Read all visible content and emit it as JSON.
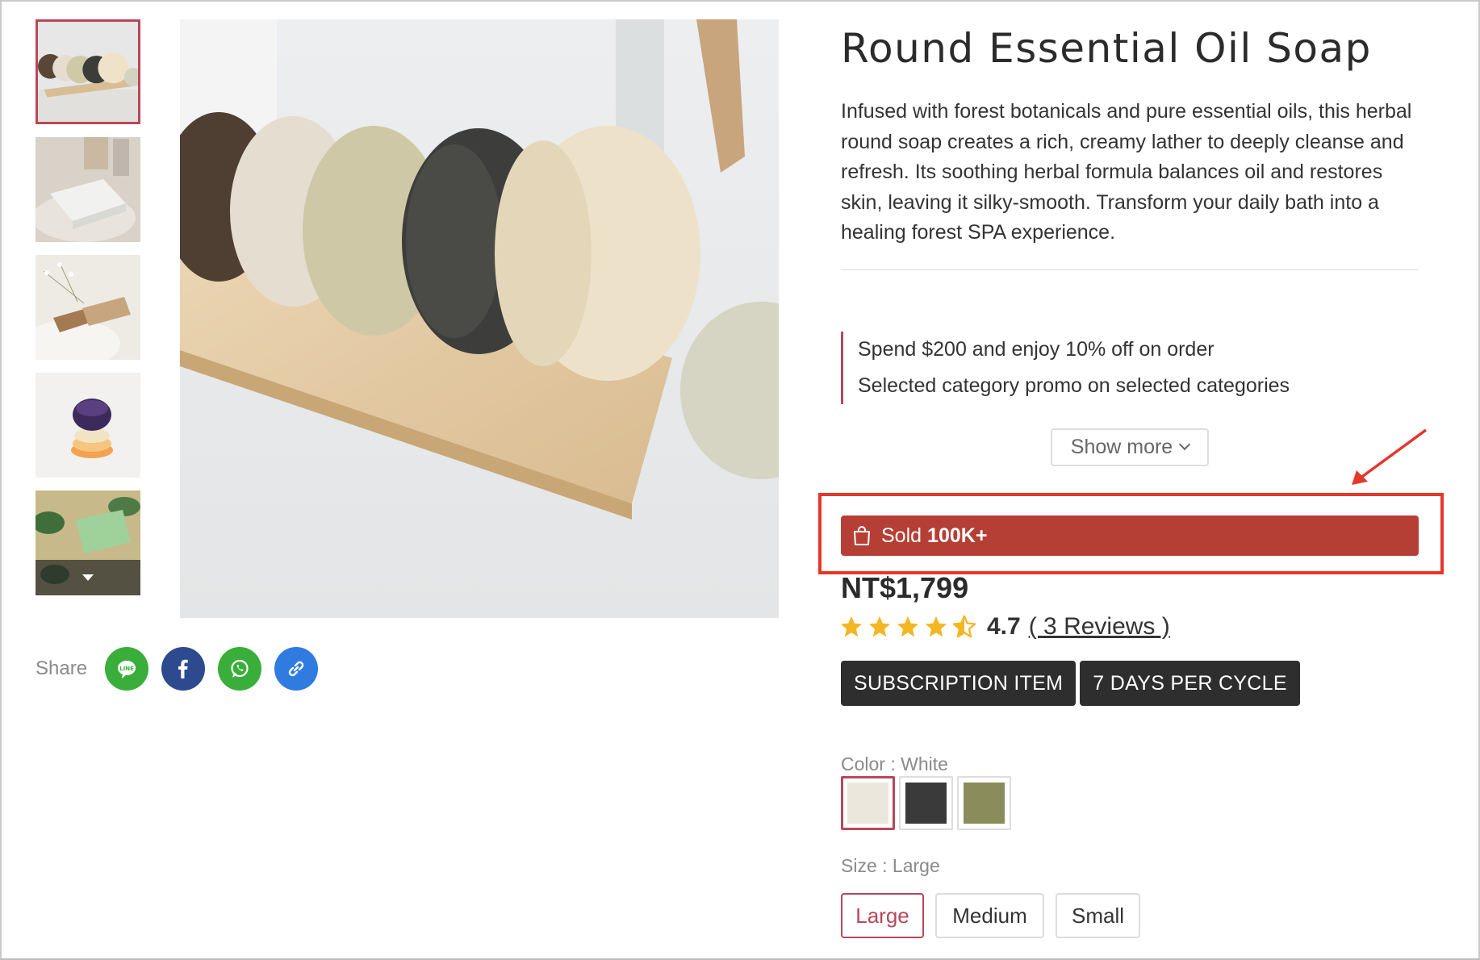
{
  "product": {
    "title": "Round Essential Oil Soap",
    "description": "Infused with forest botanicals and pure essential oils, this herbal round soap creates a rich, creamy lather to deeply cleanse and refresh. Its soothing herbal formula balances oil and restores skin, leaving it silky-smooth. Transform your daily bath into a healing forest SPA experience.",
    "price": "NT$1,799",
    "rating": "4.7",
    "rating_stars": 4.5,
    "reviews_label": "( 3 Reviews )"
  },
  "gallery": {
    "thumbnail_count": 5,
    "active_index": 0
  },
  "share": {
    "label": "Share",
    "buttons": [
      {
        "name": "line-share-icon",
        "color": "#3aae3a"
      },
      {
        "name": "facebook-share-icon",
        "color": "#2d4a8f"
      },
      {
        "name": "whatsapp-share-icon",
        "color": "#3aae3a"
      },
      {
        "name": "copy-link-icon",
        "color": "#2f7be0"
      }
    ]
  },
  "promotions": {
    "items": [
      "Spend $200 and enjoy 10% off on order",
      "Selected category promo on selected categories"
    ],
    "show_more_label": "Show more"
  },
  "sold": {
    "prefix": "Sold",
    "count": "100K+",
    "bar_color": "#b53f34",
    "highlight_color": "#e5372a"
  },
  "tags": [
    "SUBSCRIPTION ITEM",
    "7 DAYS PER CYCLE"
  ],
  "color_option": {
    "label": "Color : White",
    "swatches": [
      {
        "name": "White",
        "hex": "#ebe7dc"
      },
      {
        "name": "Black",
        "hex": "#3a3a3a"
      },
      {
        "name": "Green",
        "hex": "#8a8c5b"
      }
    ],
    "selected_index": 0
  },
  "size_option": {
    "label": "Size : Large",
    "options": [
      "Large",
      "Medium",
      "Small"
    ],
    "selected_index": 0
  },
  "colors": {
    "accent": "#b8475b",
    "star": "#f5b623"
  }
}
